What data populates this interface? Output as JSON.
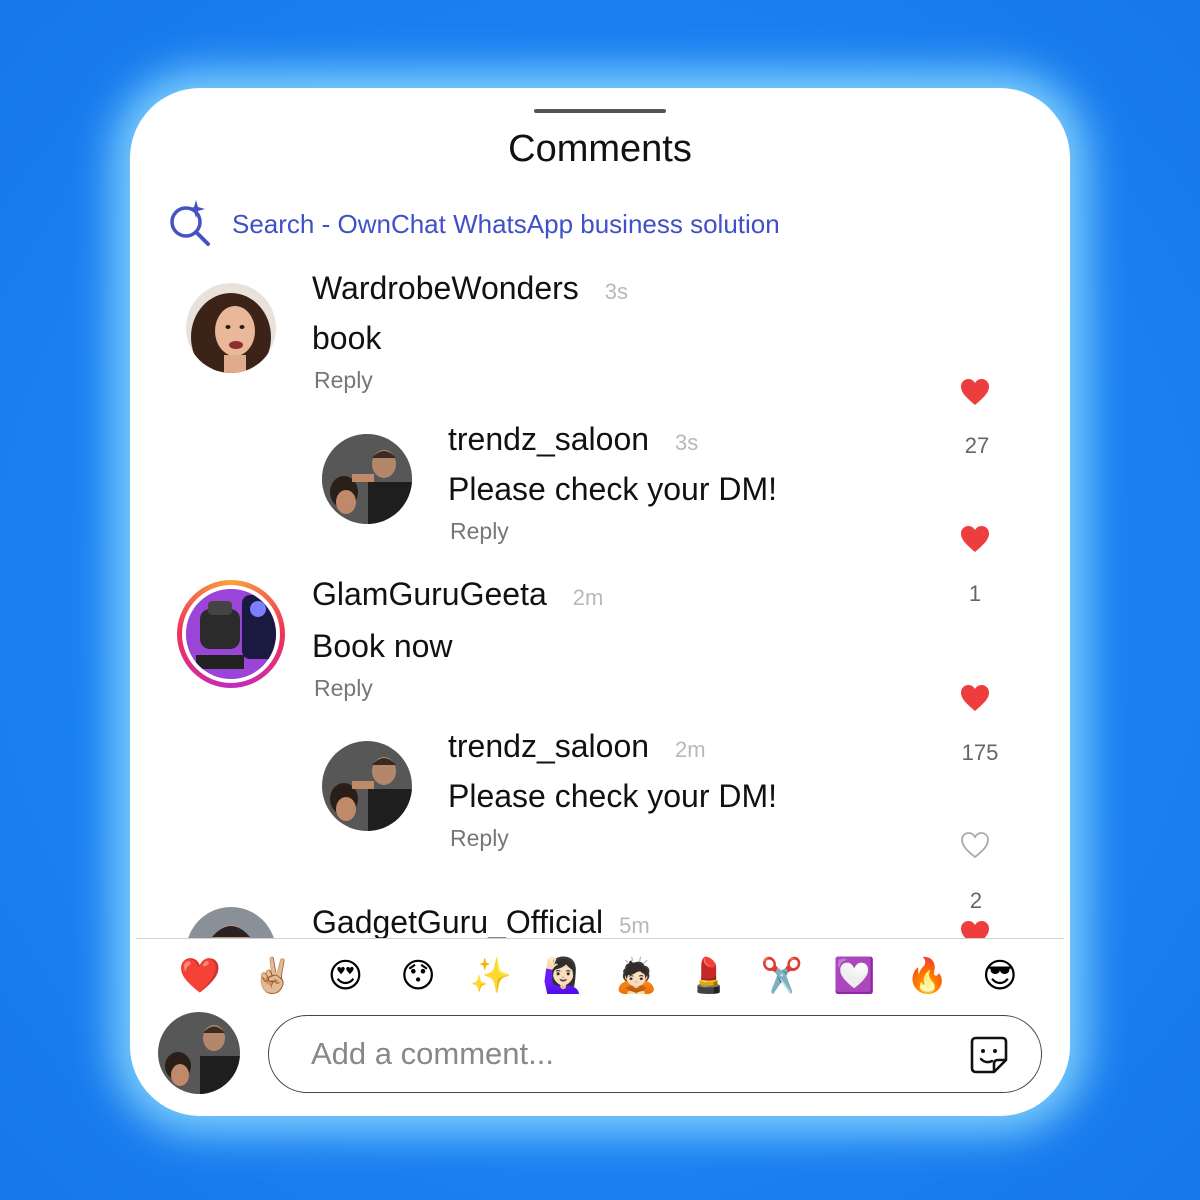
{
  "header": {
    "title": "Comments"
  },
  "search": {
    "label": "Search - OwnChat WhatsApp business solution",
    "icon": "sparkle-search-icon",
    "color": "#3f50c8"
  },
  "comments": [
    {
      "username": "WardrobeWonders",
      "time": "3s",
      "text": "book",
      "reply_label": "Reply",
      "likes": "27",
      "liked": true
    },
    {
      "username": "trendz_saloon",
      "time": "3s",
      "text": "Please check your DM!",
      "reply_label": "Reply",
      "likes": "1",
      "liked": true,
      "is_reply": true
    },
    {
      "username": "GlamGuruGeeta",
      "time": "2m",
      "text": "Book now",
      "reply_label": "Reply",
      "likes": "175",
      "liked": true,
      "has_story_ring": true
    },
    {
      "username": "trendz_saloon",
      "time": "2m",
      "text": "Please check your DM!",
      "reply_label": "Reply",
      "likes": "2",
      "liked": false,
      "is_reply": true
    },
    {
      "username": "GadgetGuru_Official",
      "time": "5m",
      "liked": true
    }
  ],
  "emoji_bar": [
    "❤️",
    "✌🏼",
    "😍",
    "😯",
    "✨",
    "🙋🏻‍♀️",
    "🙇🏻",
    "💄",
    "✂️",
    "💟",
    "🔥",
    "😎"
  ],
  "composer": {
    "placeholder": "Add a comment...",
    "sticker_icon": "sticker-icon"
  },
  "colors": {
    "background": "#1a7ff0",
    "heart": "#ee3d3d",
    "link": "#3f50c8"
  }
}
